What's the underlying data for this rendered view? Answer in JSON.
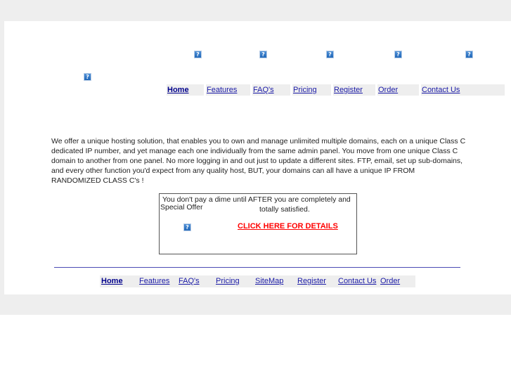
{
  "header": {
    "icons": [
      {
        "name": "broken-image-icon",
        "glyph": "?"
      },
      {
        "name": "broken-image-icon",
        "glyph": "?"
      },
      {
        "name": "broken-image-icon",
        "glyph": "?"
      },
      {
        "name": "broken-image-icon",
        "glyph": "?"
      },
      {
        "name": "broken-image-icon",
        "glyph": "?"
      },
      {
        "name": "broken-image-icon",
        "glyph": "?"
      }
    ]
  },
  "top_nav": {
    "items": [
      {
        "label": "Home"
      },
      {
        "label": "Features"
      },
      {
        "label": "FAQ's"
      },
      {
        "label": "Pricing"
      },
      {
        "label": "Register"
      },
      {
        "label": "Order"
      },
      {
        "label": "Contact Us"
      }
    ]
  },
  "intro": {
    "text": "We offer a unique hosting solution, that enables you to own and manage unlimited multiple domains, each on a unique Class C dedicated IP number, and yet manage each one individually from the same admin panel. You move from one unique Class C domain to another from one panel. No more logging in and out just to update a different sites. FTP, email, set up sub-domains, and every other function you'd expect from any quality host, BUT, your domains can all have a unique IP FROM RANDOMIZED CLASS C's !"
  },
  "offer": {
    "line1": "You don't pay a dime until AFTER you are completely and",
    "line2": "totally satisfied.",
    "label": "Special Offer",
    "link": "CLICK HERE FOR DETAILS",
    "link_color": "#ff0000"
  },
  "bottom_nav": {
    "items": [
      {
        "label": "Home"
      },
      {
        "label": "Features"
      },
      {
        "label": "FAQ's"
      },
      {
        "label": "Pricing"
      },
      {
        "label": "SiteMap"
      },
      {
        "label": "Register"
      },
      {
        "label": "Contact Us"
      },
      {
        "label": "Order"
      }
    ]
  },
  "colors": {
    "page_bg": "#eeeeee",
    "link": "#1a1aa6",
    "divider": "#4b4bb5"
  }
}
